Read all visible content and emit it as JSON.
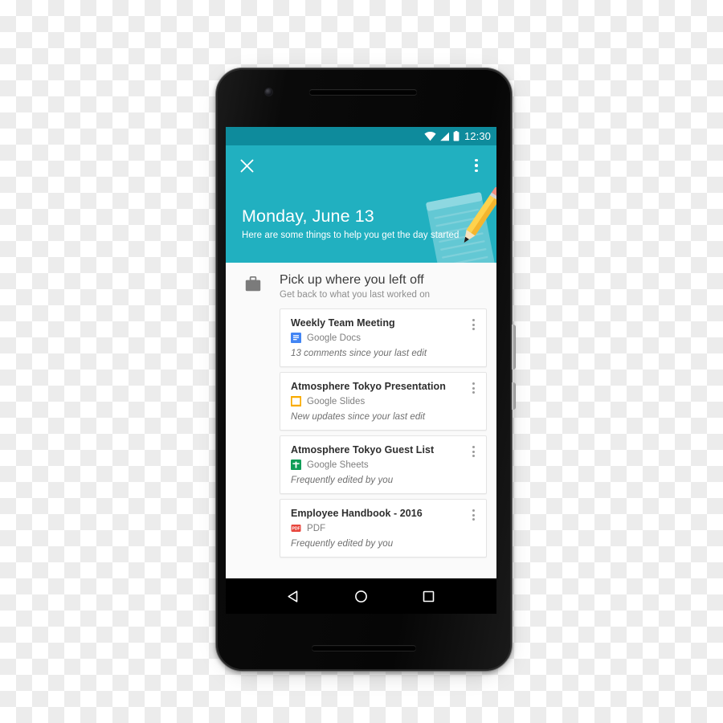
{
  "status_bar": {
    "time": "12:30",
    "icons": [
      "wifi-icon",
      "signal-icon",
      "battery-icon"
    ]
  },
  "header": {
    "close_icon": "close-icon",
    "overflow_icon": "overflow-menu-icon",
    "title": "Monday, June 13",
    "subtitle": "Here are some things to help you get the day started",
    "illustration": "notepad-pencil-illustration",
    "background_color": "#21b0c0",
    "status_bar_color": "#0e8b9c"
  },
  "section": {
    "icon": "briefcase-icon",
    "title": "Pick up where you left off",
    "subtitle": "Get back to what you last worked on"
  },
  "cards": [
    {
      "title": "Weekly Team Meeting",
      "type_icon": "google-docs-icon",
      "type_label": "Google Docs",
      "note": "13 comments since your last edit",
      "color": "#4285f4"
    },
    {
      "title": "Atmosphere Tokyo Presentation",
      "type_icon": "google-slides-icon",
      "type_label": "Google Slides",
      "note": "New updates since your last edit",
      "color": "#f9ab00"
    },
    {
      "title": "Atmosphere Tokyo Guest List",
      "type_icon": "google-sheets-icon",
      "type_label": "Google Sheets",
      "note": "Frequently edited by you",
      "color": "#0f9d58"
    },
    {
      "title": "Employee Handbook - 2016",
      "type_icon": "pdf-icon",
      "type_label": "PDF",
      "note": "Frequently edited by you",
      "color": "#e8453c"
    }
  ],
  "nav_bar": {
    "back": "back-triangle-icon",
    "home": "home-circle-icon",
    "recents": "recents-square-icon"
  }
}
